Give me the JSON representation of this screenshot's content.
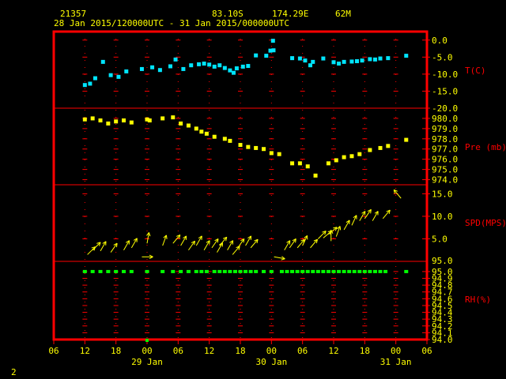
{
  "header": {
    "station_id": "21357",
    "lat": "83.10S",
    "lon": "174.29E",
    "elev": "62M",
    "period": "28 Jan 2015/120000UTC - 31 Jan 2015/000000UTC"
  },
  "footer": {
    "page_number": "2"
  },
  "colors": {
    "frame": "#ff0000",
    "grid": "#ff0000",
    "temp": "#00e5ff",
    "pressure": "#ffff00",
    "wind": "#ffff00",
    "rh": "#00ff00",
    "axis_text": "#ffff00",
    "label_text": "#ff0000"
  },
  "chart_data": {
    "type": "scatter",
    "x_ticks": [
      "06",
      "12",
      "18",
      "00",
      "06",
      "12",
      "18",
      "00",
      "06",
      "12",
      "18",
      "00",
      "06"
    ],
    "x_tick_hours": [
      -6,
      0,
      6,
      12,
      18,
      24,
      30,
      36,
      42,
      48,
      54,
      60,
      66
    ],
    "x_date_labels": [
      {
        "label": "29 Jan",
        "hour": 12
      },
      {
        "label": "30 Jan",
        "hour": 36
      },
      {
        "label": "31 Jan",
        "hour": 60
      }
    ],
    "xlim": [
      -6,
      66
    ],
    "panels": [
      {
        "id": "temp",
        "label": "T(C)",
        "ylim": [
          -20,
          2.5
        ],
        "ticks": [
          "0.0",
          "-5.0",
          "-10.0",
          "-15.0",
          "-20.0"
        ],
        "tick_values": [
          0,
          -5,
          -10,
          -15,
          -20
        ],
        "points": [
          [
            0,
            -13.2
          ],
          [
            1,
            -12.8
          ],
          [
            2,
            -11.2
          ],
          [
            3.5,
            -6.4
          ],
          [
            5,
            -10.3
          ],
          [
            6.5,
            -10.8
          ],
          [
            8,
            -9.2
          ],
          [
            11,
            -8.5
          ],
          [
            13,
            -8.0
          ],
          [
            14.5,
            -8.8
          ],
          [
            16.5,
            -7.7
          ],
          [
            17.5,
            -5.7
          ],
          [
            19,
            -8.5
          ],
          [
            20.5,
            -7.4
          ],
          [
            22,
            -7.1
          ],
          [
            23,
            -6.9
          ],
          [
            24,
            -7.2
          ],
          [
            25,
            -7.8
          ],
          [
            26,
            -7.4
          ],
          [
            27,
            -8.2
          ],
          [
            28,
            -8.9
          ],
          [
            28.7,
            -9.6
          ],
          [
            29.3,
            -8.3
          ],
          [
            30.5,
            -7.8
          ],
          [
            31.5,
            -7.6
          ],
          [
            33,
            -4.5
          ],
          [
            35,
            -4.6
          ],
          [
            35.8,
            -3.1
          ],
          [
            36.3,
            -0.2
          ],
          [
            36.4,
            -3.0
          ],
          [
            40,
            -5.3
          ],
          [
            41.5,
            -5.4
          ],
          [
            42.5,
            -6.0
          ],
          [
            43.5,
            -7.4
          ],
          [
            44,
            -6.4
          ],
          [
            46,
            -5.4
          ],
          [
            48,
            -6.5
          ],
          [
            49,
            -6.9
          ],
          [
            50,
            -6.4
          ],
          [
            51.5,
            -6.3
          ],
          [
            52.5,
            -6.2
          ],
          [
            53.5,
            -6.0
          ],
          [
            55,
            -5.6
          ],
          [
            56,
            -5.7
          ],
          [
            57,
            -5.4
          ],
          [
            58.5,
            -5.3
          ],
          [
            62,
            -4.6
          ]
        ]
      },
      {
        "id": "pressure",
        "label": "Pre (mb)",
        "ylim": [
          973.5,
          981
        ],
        "ticks": [
          "980.0",
          "979.0",
          "978.0",
          "977.0",
          "976.0",
          "975.0",
          "974.0"
        ],
        "tick_values": [
          980,
          979,
          978,
          977,
          976,
          975,
          974
        ],
        "points": [
          [
            0,
            979.9
          ],
          [
            1.5,
            980.0
          ],
          [
            3,
            979.8
          ],
          [
            4.5,
            979.5
          ],
          [
            6,
            979.7
          ],
          [
            7.5,
            979.8
          ],
          [
            9,
            979.6
          ],
          [
            12,
            979.9
          ],
          [
            12.5,
            979.8
          ],
          [
            15,
            980.0
          ],
          [
            17,
            980.1
          ],
          [
            18.5,
            979.5
          ],
          [
            20,
            979.3
          ],
          [
            21.5,
            979.0
          ],
          [
            22.5,
            978.7
          ],
          [
            23.5,
            978.5
          ],
          [
            25,
            978.2
          ],
          [
            27,
            978.0
          ],
          [
            28,
            977.8
          ],
          [
            30,
            977.4
          ],
          [
            31.5,
            977.2
          ],
          [
            33,
            977.1
          ],
          [
            34.5,
            977.0
          ],
          [
            36,
            976.6
          ],
          [
            37.5,
            976.5
          ],
          [
            40,
            975.6
          ],
          [
            41.5,
            975.6
          ],
          [
            43,
            975.3
          ],
          [
            44.5,
            974.4
          ],
          [
            47,
            975.6
          ],
          [
            48.5,
            975.9
          ],
          [
            50,
            976.2
          ],
          [
            51.5,
            976.3
          ],
          [
            53,
            976.5
          ],
          [
            55,
            976.9
          ],
          [
            57,
            977.1
          ],
          [
            58.5,
            977.3
          ],
          [
            62,
            977.9
          ]
        ]
      },
      {
        "id": "wind",
        "label": "SPD(MPS)",
        "ylim": [
          0,
          17
        ],
        "ticks": [
          "15.0",
          "10.0",
          "5.0"
        ],
        "tick_values": [
          15,
          10,
          5
        ],
        "points": [
          [
            0.5,
            1.5,
            45
          ],
          [
            1.5,
            2.5,
            45
          ],
          [
            3,
            2.3,
            30
          ],
          [
            5,
            2.0,
            35
          ],
          [
            7.5,
            2.5,
            30
          ],
          [
            9,
            3.0,
            30
          ],
          [
            11,
            1.0,
            90
          ],
          [
            12,
            4.0,
            10
          ],
          [
            15,
            3.5,
            20
          ],
          [
            17,
            4.0,
            40
          ],
          [
            18.5,
            3.5,
            30
          ],
          [
            20,
            2.5,
            35
          ],
          [
            21.5,
            3.5,
            30
          ],
          [
            23,
            2.5,
            30
          ],
          [
            24.5,
            3.0,
            35
          ],
          [
            25.5,
            2.0,
            30
          ],
          [
            26,
            3.5,
            40
          ],
          [
            27.5,
            2.5,
            30
          ],
          [
            28.5,
            1.5,
            40
          ],
          [
            29.5,
            3.0,
            35
          ],
          [
            31,
            3.5,
            30
          ],
          [
            32,
            3.0,
            40
          ],
          [
            36.5,
            1.0,
            100
          ],
          [
            38.5,
            2.5,
            30
          ],
          [
            39.5,
            3.0,
            35
          ],
          [
            41,
            3.0,
            40
          ],
          [
            42,
            3.5,
            25
          ],
          [
            43.5,
            3.0,
            40
          ],
          [
            45,
            5.0,
            45
          ],
          [
            46,
            5.2,
            50
          ],
          [
            47,
            6.0,
            50
          ],
          [
            47.5,
            4.5,
            0
          ],
          [
            48.5,
            5.5,
            20
          ],
          [
            50,
            7.0,
            30
          ],
          [
            51.5,
            8.0,
            25
          ],
          [
            53,
            9.0,
            30
          ],
          [
            54,
            9.5,
            35
          ],
          [
            55.5,
            9.0,
            30
          ],
          [
            57.5,
            9.5,
            40
          ],
          [
            61,
            14.0,
            320
          ]
        ]
      },
      {
        "id": "rh",
        "label": "RH(%)",
        "ylim": [
          94.0,
          95.15
        ],
        "ticks": [
          "95.0",
          "94.9",
          "94.8",
          "94.7",
          "94.6",
          "94.5",
          "94.4",
          "94.3",
          "94.2",
          "94.1",
          "94.0"
        ],
        "tick_values": [
          95.0,
          94.9,
          94.8,
          94.7,
          94.6,
          94.5,
          94.4,
          94.3,
          94.2,
          94.1,
          94.0
        ],
        "top_value": "95.0",
        "points": [
          [
            0,
            95.0
          ],
          [
            1.5,
            95.0
          ],
          [
            3,
            95.0
          ],
          [
            4.5,
            95.0
          ],
          [
            6,
            95.0
          ],
          [
            7.5,
            95.0
          ],
          [
            9,
            95.0
          ],
          [
            12,
            95.0
          ],
          [
            15,
            95.0
          ],
          [
            17,
            95.0
          ],
          [
            18.5,
            95.0
          ],
          [
            20,
            95.0
          ],
          [
            21.5,
            95.0
          ],
          [
            22.5,
            95.0
          ],
          [
            23.5,
            95.0
          ],
          [
            25,
            95.0
          ],
          [
            26,
            95.0
          ],
          [
            27,
            95.0
          ],
          [
            28,
            95.0
          ],
          [
            29,
            95.0
          ],
          [
            30,
            95.0
          ],
          [
            31,
            95.0
          ],
          [
            32,
            95.0
          ],
          [
            33,
            95.0
          ],
          [
            34.5,
            95.0
          ],
          [
            36,
            95.0
          ],
          [
            38,
            95.0
          ],
          [
            39,
            95.0
          ],
          [
            40,
            95.0
          ],
          [
            41,
            95.0
          ],
          [
            42,
            95.0
          ],
          [
            43,
            95.0
          ],
          [
            44,
            95.0
          ],
          [
            45,
            95.0
          ],
          [
            46,
            95.0
          ],
          [
            47,
            95.0
          ],
          [
            48,
            95.0
          ],
          [
            49,
            95.0
          ],
          [
            50,
            95.0
          ],
          [
            51,
            95.0
          ],
          [
            52,
            95.0
          ],
          [
            53,
            95.0
          ],
          [
            54,
            95.0
          ],
          [
            55,
            95.0
          ],
          [
            56,
            95.0
          ],
          [
            57,
            95.0
          ],
          [
            58,
            95.0
          ],
          [
            62,
            95.0
          ]
        ]
      }
    ]
  }
}
